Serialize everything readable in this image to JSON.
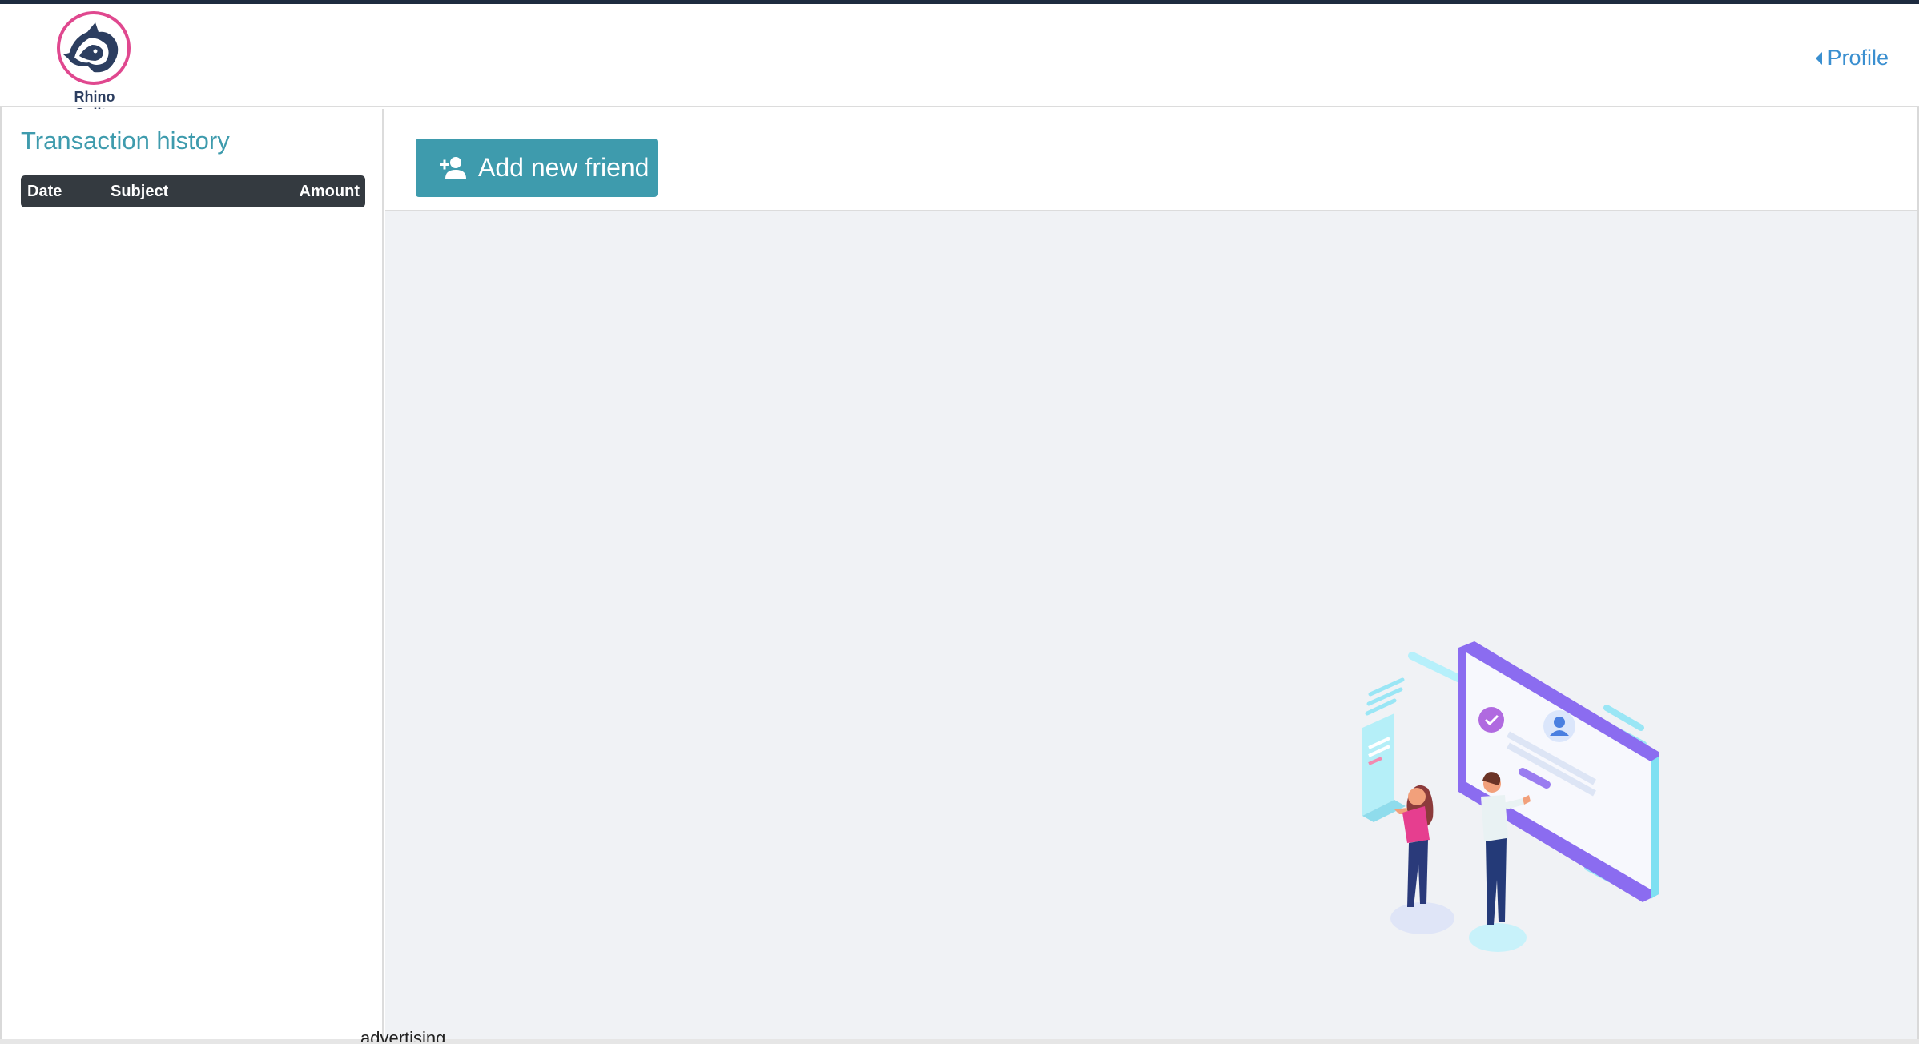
{
  "header": {
    "brand_name": "Rhino Splits",
    "profile_label": "Profile"
  },
  "sidebar": {
    "title": "Transaction history",
    "table": {
      "columns": [
        "Date",
        "Subject",
        "Amount"
      ],
      "rows": []
    }
  },
  "toolbar": {
    "add_friend_label": "Add new friend"
  },
  "footer": {
    "clipped_text": "advertising"
  },
  "colors": {
    "accent": "#3e9bad",
    "link": "#3a8fd0",
    "logo_ring": "#e0488f",
    "table_header": "#343a40",
    "main_bg": "#f0f2f5"
  },
  "icons": [
    "rhino-logo-icon",
    "caret-left-icon",
    "user-plus-icon",
    "friends-illustration"
  ]
}
